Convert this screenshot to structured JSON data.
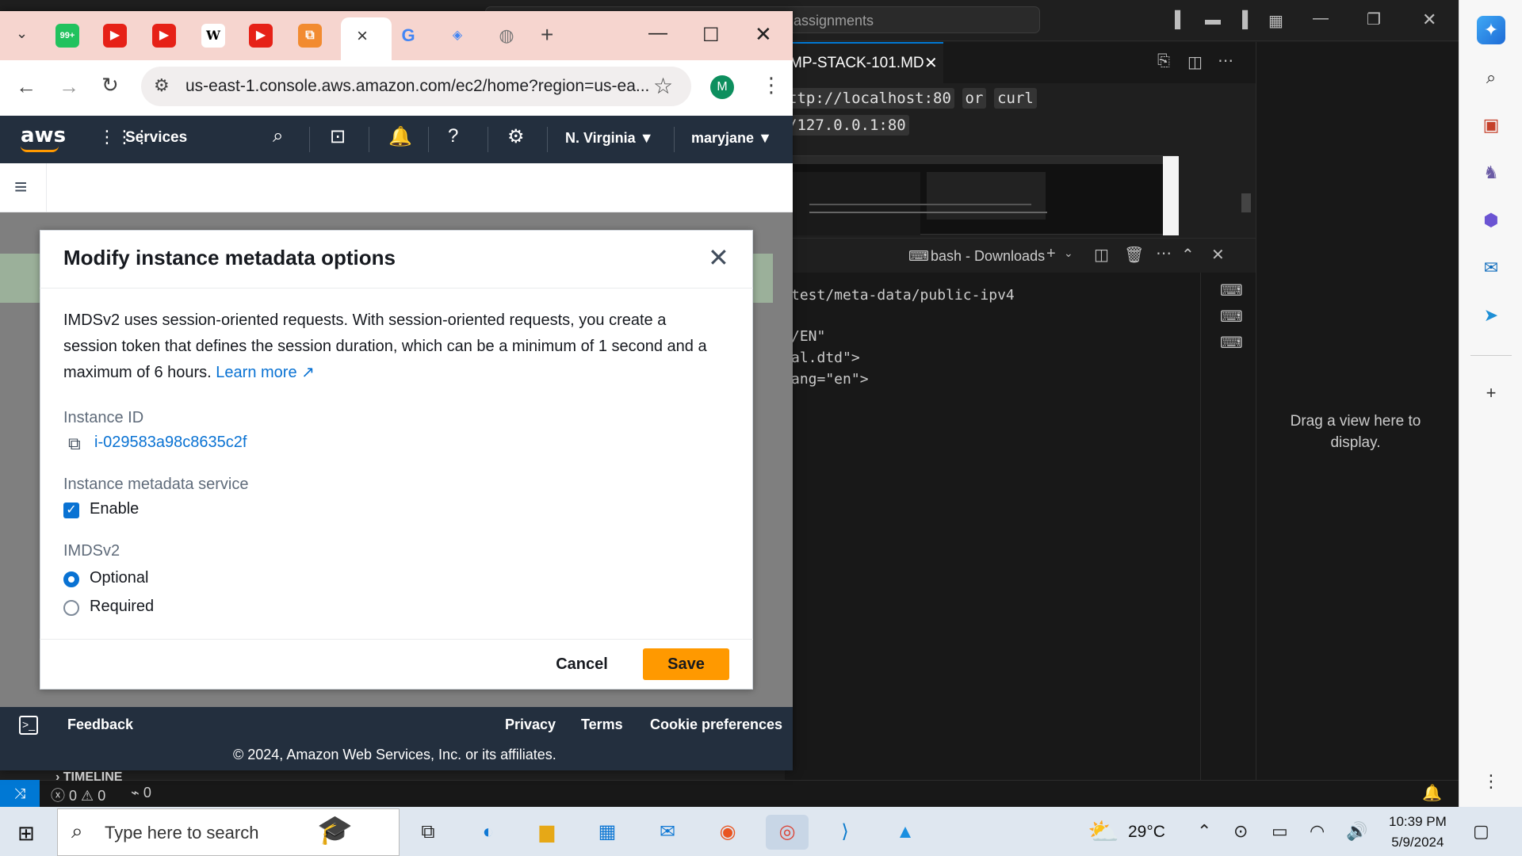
{
  "vscode": {
    "command_center": "assignments",
    "editor_tab": "MP-STACK-101.MD",
    "code_line1_a": "ttp://localhost:80",
    "code_line1_b": "or",
    "code_line1_c": "curl",
    "code_line2": "/127.0.0.1:80",
    "terminal_title": "bash - Downloads",
    "terminal_lines": [
      "test/meta-data/public-ipv4",
      "/EN\"",
      "al.dtd\">",
      "ang=\"en\">"
    ],
    "aux_message": "Drag a view here to display.",
    "status_problems": "0",
    "status_warnings": "0",
    "status_ports": "0",
    "timeline_label": "TIMELINE"
  },
  "browser": {
    "url": "us-east-1.console.aws.amazon.com/ec2/home?region=us-ea...",
    "profile_initial": "M",
    "tab_close": "×",
    "new_tab": "+"
  },
  "aws": {
    "services_label": "Services",
    "region_label": "N. Virginia",
    "user_label": "maryjane",
    "footer": {
      "feedback": "Feedback",
      "privacy": "Privacy",
      "terms": "Terms",
      "cookie": "Cookie preferences",
      "copyright": "© 2024, Amazon Web Services, Inc. or its affiliates."
    }
  },
  "modal": {
    "title": "Modify instance metadata options",
    "description": "IMDSv2 uses session-oriented requests. With session-oriented requests, you create a session token that defines the session duration, which can be a minimum of 1 second and a maximum of 6 hours.",
    "learn_more": "Learn more",
    "instance_id_label": "Instance ID",
    "instance_id": "i-029583a98c8635c2f",
    "metadata_service_label": "Instance metadata service",
    "enable_label": "Enable",
    "enable_checked": true,
    "imdsv2_label": "IMDSv2",
    "option_optional": "Optional",
    "option_required": "Required",
    "selected_option": "Optional",
    "cancel_label": "Cancel",
    "save_label": "Save"
  },
  "taskbar": {
    "search_placeholder": "Type here to search",
    "temperature": "29°C",
    "time": "10:39 PM",
    "date": "5/9/2024"
  },
  "colors": {
    "aws_nav": "#232f3e",
    "aws_orange": "#ff9900",
    "link_blue": "#0972d3",
    "chrome_tabstrip": "#f6d5cf",
    "vscode_bg": "#1f1f1f"
  }
}
